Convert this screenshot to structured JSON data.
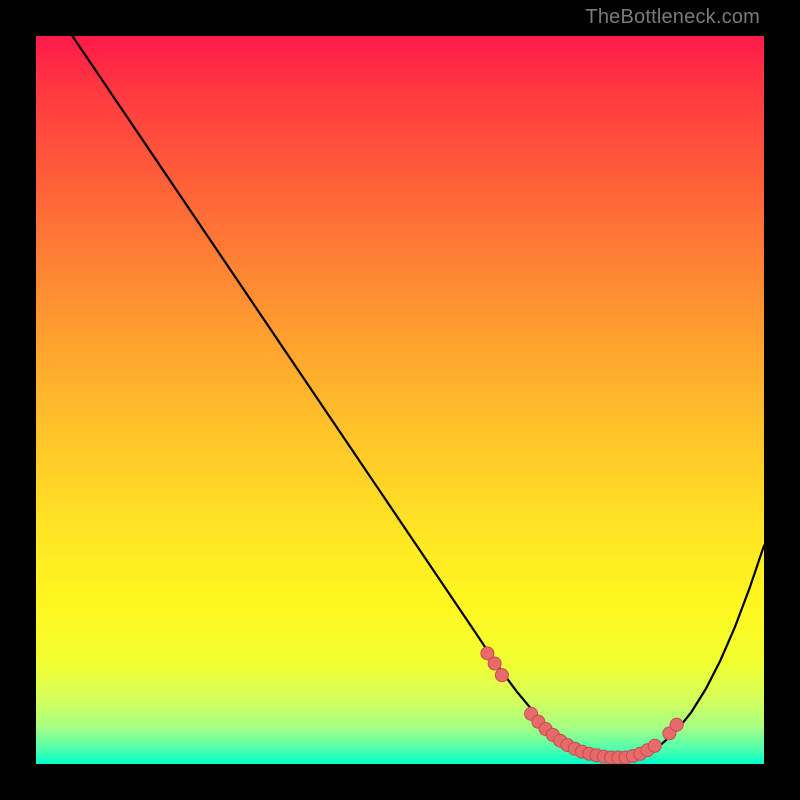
{
  "watermark": "TheBottleneck.com",
  "colors": {
    "frame": "#000000",
    "curve": "#000000",
    "marker_fill": "#e86a6a",
    "marker_stroke": "#c14f4f",
    "gradient_top": "#ff1a4a",
    "gradient_bottom": "#00ffc8"
  },
  "chart_data": {
    "type": "line",
    "title": "",
    "xlabel": "",
    "ylabel": "",
    "xlim": [
      0,
      100
    ],
    "ylim": [
      0,
      100
    ],
    "grid": false,
    "legend": null,
    "series": [
      {
        "name": "curve",
        "x": [
          5,
          10,
          15,
          20,
          25,
          30,
          35,
          40,
          45,
          50,
          55,
          60,
          62,
          64,
          66,
          68,
          70,
          72,
          74,
          76,
          78,
          80,
          82,
          84,
          86,
          88,
          90,
          92,
          94,
          96,
          98,
          100
        ],
        "y": [
          100,
          92.6,
          85.2,
          77.8,
          70.4,
          63,
          55.6,
          48.2,
          40.8,
          33.4,
          26,
          18.6,
          15.6,
          12.7,
          10,
          7.6,
          5.5,
          3.9,
          2.7,
          1.8,
          1.2,
          0.9,
          1,
          1.6,
          2.8,
          4.6,
          7.1,
          10.3,
          14.2,
          18.8,
          24.1,
          30
        ]
      }
    ],
    "markers": [
      {
        "x": 62,
        "y": 15.2
      },
      {
        "x": 63,
        "y": 13.8
      },
      {
        "x": 64,
        "y": 12.2
      },
      {
        "x": 68,
        "y": 6.9
      },
      {
        "x": 69,
        "y": 5.8
      },
      {
        "x": 70,
        "y": 4.8
      },
      {
        "x": 71,
        "y": 4.0
      },
      {
        "x": 72,
        "y": 3.2
      },
      {
        "x": 73,
        "y": 2.6
      },
      {
        "x": 74,
        "y": 2.1
      },
      {
        "x": 75,
        "y": 1.7
      },
      {
        "x": 76,
        "y": 1.4
      },
      {
        "x": 77,
        "y": 1.2
      },
      {
        "x": 78,
        "y": 1.0
      },
      {
        "x": 79,
        "y": 0.9
      },
      {
        "x": 80,
        "y": 0.9
      },
      {
        "x": 81,
        "y": 0.9
      },
      {
        "x": 82,
        "y": 1.1
      },
      {
        "x": 83,
        "y": 1.4
      },
      {
        "x": 84,
        "y": 1.9
      },
      {
        "x": 85,
        "y": 2.5
      },
      {
        "x": 87,
        "y": 4.2
      },
      {
        "x": 88,
        "y": 5.4
      }
    ],
    "annotations": []
  }
}
